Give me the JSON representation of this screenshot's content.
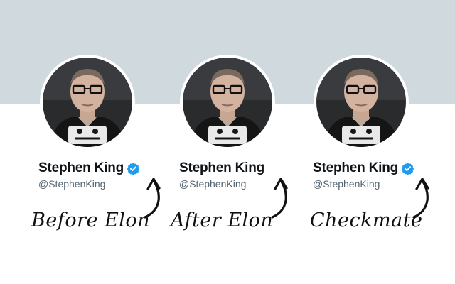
{
  "profiles": [
    {
      "name": "Stephen King",
      "handle": "@StephenKing",
      "caption": "Before Elon",
      "verified": true
    },
    {
      "name": "Stephen King",
      "handle": "@StephenKing",
      "caption": "After Elon",
      "verified": false
    },
    {
      "name": "Stephen King",
      "handle": "@StephenKing",
      "caption": "Checkmate",
      "verified": true
    }
  ],
  "colors": {
    "banner": "#cfd9de",
    "verified_badge": "#1d9bf0",
    "name_text": "#0f1419",
    "handle_text": "#536471"
  },
  "icons": {
    "verified": "verified-badge-icon",
    "arrow": "curved-arrow-icon",
    "avatar": "profile-photo"
  }
}
